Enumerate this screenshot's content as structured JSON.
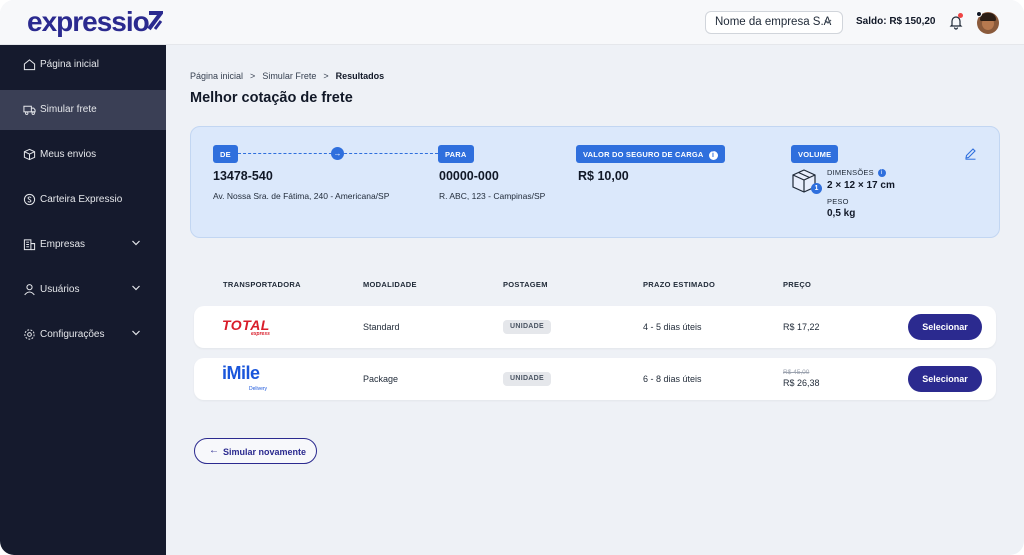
{
  "topbar": {
    "logo": "expressio",
    "company": "Nome da empresa S.A",
    "balance": "Saldo: R$ 150,20"
  },
  "sidebar": {
    "items": [
      {
        "label": "Página inicial",
        "icon": "home-icon"
      },
      {
        "label": "Simular frete",
        "icon": "truck-icon",
        "active": true
      },
      {
        "label": "Meus envios",
        "icon": "package-icon"
      },
      {
        "label": "Carteira Expressio",
        "icon": "wallet-icon"
      },
      {
        "label": "Empresas",
        "icon": "building-icon",
        "expandable": true
      },
      {
        "label": "Usuários",
        "icon": "user-icon",
        "expandable": true
      },
      {
        "label": "Configurações",
        "icon": "gear-icon",
        "expandable": true
      }
    ]
  },
  "breadcrumb": {
    "items": [
      "Página inicial",
      "Simular Frete",
      "Resultados"
    ],
    "separator": ">"
  },
  "page_title": "Melhor cotação de frete",
  "quote": {
    "from_label": "DE",
    "from_cep": "13478-540",
    "from_address": "Av. Nossa Sra. de Fátima, 240 - Americana/SP",
    "to_label": "PARA",
    "to_cep": "00000-000",
    "to_address": "R. ABC, 123 - Campinas/SP",
    "insurance_label": "VALOR DO SEGURO DE CARGA",
    "insurance_value": "R$ 10,00",
    "volume_label": "VOLUME",
    "volume_count": "1",
    "dimensions_label": "DIMENSÕES",
    "dimensions_value": "2 × 12 × 17 cm",
    "weight_label": "PESO",
    "weight_value": "0,5 kg",
    "info_glyph": "i"
  },
  "table": {
    "headers": [
      "TRANSPORTADORA",
      "MODALIDADE",
      "POSTAGEM",
      "PRAZO ESTIMADO",
      "PREÇO"
    ],
    "rows": [
      {
        "carrier_logo": "TOTAL",
        "carrier_sub": "express",
        "modality": "Standard",
        "posting": "UNIDADE",
        "eta": "4 - 5 dias úteis",
        "old_price": "",
        "price": "R$ 17,22",
        "button": "Selecionar"
      },
      {
        "carrier_logo": "iMile",
        "carrier_sub": "Delivery",
        "modality": "Package",
        "posting": "UNIDADE",
        "eta": "6 - 8 dias úteis",
        "old_price": "R$ 45,00",
        "price": "R$ 26,38",
        "button": "Selecionar"
      }
    ]
  },
  "again_button": "Simular novamente",
  "colors": {
    "brand": "#2b2a8f",
    "accent": "#2f6fdd",
    "sidebar": "#151a2d",
    "card": "#dbe8fb"
  }
}
